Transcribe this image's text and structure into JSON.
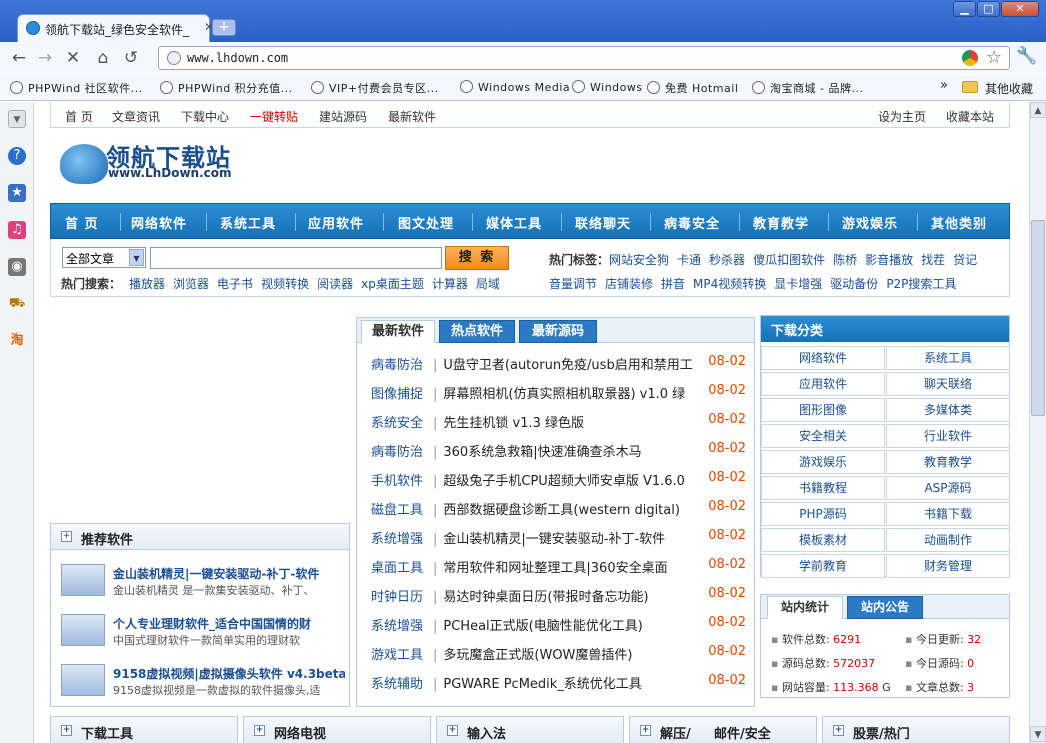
{
  "browser": {
    "tab_title": "领航下载站_绿色安全软件_",
    "url": "www.lhdown.com",
    "bookmarks": [
      "PHPWind 社区软件...",
      "PHPWind 积分充值...",
      "VIP+付费会员专区...",
      "Windows Media",
      "Windows",
      "免费 Hotmail",
      "淘宝商城 - 品牌..."
    ],
    "more": "»",
    "other_bookmarks": "其他收藏"
  },
  "topnav": {
    "left": [
      "首 页",
      "文章资讯",
      "下载中心",
      "一键转贴",
      "建站源码",
      "最新软件"
    ],
    "right": [
      "设为主页",
      "收藏本站"
    ]
  },
  "logo": {
    "cn": "领航下载站",
    "en": "www.LhDown.com"
  },
  "mainnav": [
    "首 页",
    "网络软件",
    "系统工具",
    "应用软件",
    "图文处理",
    "媒体工具",
    "联络聊天",
    "病毒安全",
    "教育教学",
    "游戏娱乐",
    "其他类别"
  ],
  "search": {
    "select": "全部文章",
    "button": "搜 索",
    "hot_label": "热门搜索：",
    "hot": [
      "播放器",
      "浏览器",
      "电子书",
      "视频转换",
      "阅读器",
      "xp桌面主题",
      "计算器",
      "局域"
    ],
    "tag_label": "热门标签：",
    "tags1": [
      "网站安全狗",
      "卡通",
      "秒杀器",
      "傻瓜扣图软件",
      "陈桥",
      "影音播放",
      "找茬",
      "贷记"
    ],
    "tags2": [
      "音量调节",
      "店铺装修",
      "拼音",
      "MP4视频转换",
      "显卡增强",
      "驱动备份",
      "P2P搜索工具"
    ]
  },
  "latest": {
    "tabs": [
      "最新软件",
      "热点软件",
      "最新源码"
    ],
    "rows": [
      {
        "cat": "病毒防治",
        "name": "U盘守卫者(autorun免疫/usb启用和禁用工",
        "date": "08-02"
      },
      {
        "cat": "图像捕捉",
        "name": "屏幕照相机(仿真实照相机取景器) v1.0 绿",
        "date": "08-02"
      },
      {
        "cat": "系统安全",
        "name": "先生挂机锁 v1.3 绿色版",
        "date": "08-02"
      },
      {
        "cat": "病毒防治",
        "name": "360系统急救箱|快速准确查杀木马",
        "date": "08-02"
      },
      {
        "cat": "手机软件",
        "name": "超级兔子手机CPU超频大师安卓版 V1.6.0",
        "date": "08-02"
      },
      {
        "cat": "磁盘工具",
        "name": "西部数据硬盘诊断工具(western digital)",
        "date": "08-02"
      },
      {
        "cat": "系统增强",
        "name": "金山装机精灵|一键安装驱动-补丁-软件",
        "date": "08-02"
      },
      {
        "cat": "桌面工具",
        "name": "常用软件和网址整理工具|360安全桌面",
        "date": "08-02"
      },
      {
        "cat": "时钟日历",
        "name": "易达时钟桌面日历(带报时备忘功能)",
        "date": "08-02"
      },
      {
        "cat": "系统增强",
        "name": "PCHeal正式版(电脑性能优化工具)",
        "date": "08-02"
      },
      {
        "cat": "游戏工具",
        "name": "多玩魔盒正式版(WOW魔兽插件)",
        "date": "08-02"
      },
      {
        "cat": "系统辅助",
        "name": "PGWARE PcMedik_系统优化工具",
        "date": "08-02"
      }
    ]
  },
  "categories": {
    "title": "下载分类",
    "items": [
      "网络软件",
      "系统工具",
      "应用软件",
      "聊天联络",
      "图形图像",
      "多媒体类",
      "安全相关",
      "行业软件",
      "游戏娱乐",
      "教育教学",
      "书籍教程",
      "ASP源码",
      "PHP源码",
      "书籍下载",
      "模板素材",
      "动画制作",
      "学前教育",
      "财务管理"
    ]
  },
  "stats": {
    "tabs": [
      "站内统计",
      "站内公告"
    ],
    "items": [
      {
        "label": "软件总数:",
        "value": "6291",
        "unit": ""
      },
      {
        "label": "今日更新:",
        "value": "32",
        "unit": ""
      },
      {
        "label": "源码总数:",
        "value": "572037",
        "unit": ""
      },
      {
        "label": "今日源码:",
        "value": "0",
        "unit": ""
      },
      {
        "label": "网站容量:",
        "value": "113.368",
        "unit": "G"
      },
      {
        "label": "文章总数:",
        "value": "3",
        "unit": ""
      }
    ]
  },
  "recommend": {
    "title": "推荐软件",
    "items": [
      {
        "title": "金山装机精灵|一键安装驱动-补丁-软件",
        "desc": "金山装机精灵 是一款集安装驱动、补丁、"
      },
      {
        "title": "个人专业理财软件_适合中国国情的财",
        "desc": "中国式理财软件一款简单实用的理财软"
      },
      {
        "title": "9158虚拟视频|虚拟摄像头软件 v4.3beta",
        "desc": "9158虚拟视频是一款虚拟的软件摄像头,适"
      }
    ]
  },
  "bottom": [
    "下载工具",
    "网络电视",
    "输入法",
    "解压/",
    "邮件/安全",
    "股票/热门"
  ]
}
